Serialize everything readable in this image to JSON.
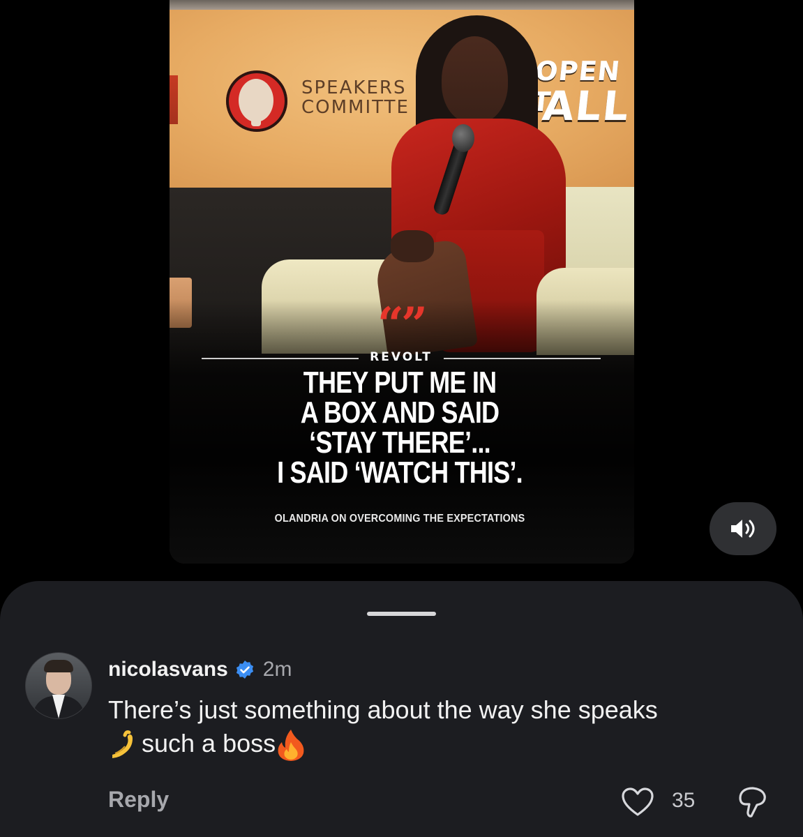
{
  "video": {
    "logo_text_line1": "SPEAKERS",
    "logo_text_line2": "COMMITTE",
    "banner_line1": "OPEN T",
    "banner_line2": "ALL",
    "quote_marks": "“”",
    "brand": "REVOLT",
    "headline_lines": [
      "THEY PUT ME IN",
      "A BOX AND SAID",
      "‘STAY THERE’...",
      "I SAID ‘WATCH THIS’."
    ],
    "subline": "OLANDRIA ON OVERCOMING THE EXPECTATIONS",
    "mute_icon": "speaker-volume-icon"
  },
  "comment": {
    "username": "nicolasvans",
    "verified_icon": "verified-badge-icon",
    "timestamp": "2m",
    "text_line1": "There’s just something about the way she speaks",
    "text_line2": "such a boss",
    "emoji_1": "pinching-hand-emoji",
    "emoji_2": "fire-emoji",
    "reply_label": "Reply",
    "like_count": "35",
    "like_icon": "heart-icon",
    "dislike_icon": "thumbs-down-icon"
  },
  "colors": {
    "background": "#000000",
    "sheet": "#1c1d21",
    "verified": "#3b8ef3",
    "quote_red": "#e6362b",
    "dress_red": "#c8261e"
  }
}
